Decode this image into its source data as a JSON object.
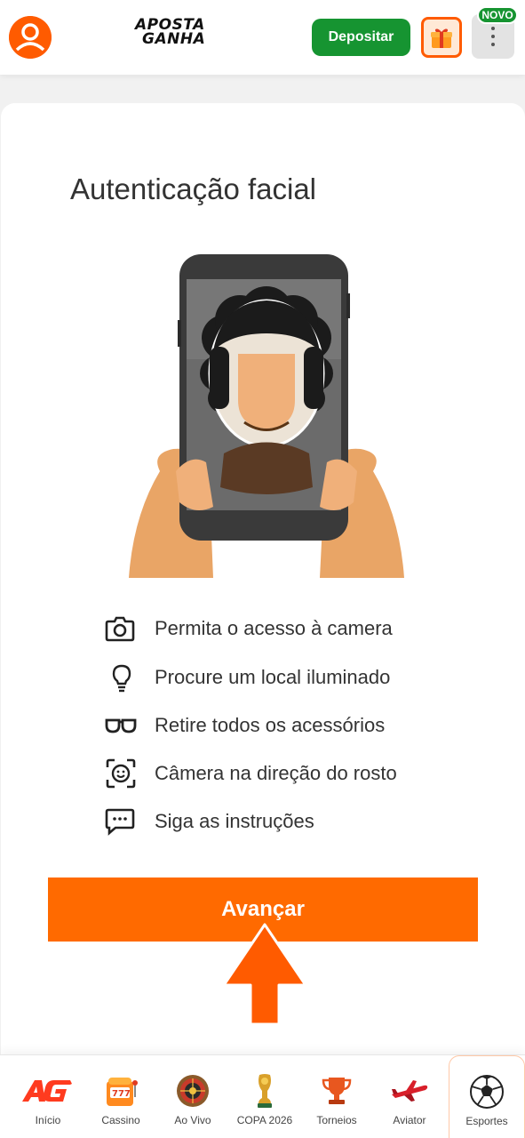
{
  "header": {
    "logo_line1": "APOSTA",
    "logo_line2": "GANHA",
    "deposit_label": "Depositar",
    "badge_label": "NOVO"
  },
  "main": {
    "title": "Autenticação facial",
    "tips": [
      {
        "icon": "camera-icon",
        "text": "Permita o acesso à camera"
      },
      {
        "icon": "lightbulb-icon",
        "text": "Procure um local iluminado"
      },
      {
        "icon": "glasses-icon",
        "text": "Retire todos os acessórios"
      },
      {
        "icon": "face-scan-icon",
        "text": "Câmera na direção do rosto"
      },
      {
        "icon": "chat-icon",
        "text": "Siga as instruções"
      }
    ],
    "advance_label": "Avançar"
  },
  "bottom_nav": [
    {
      "icon": "ag-logo-icon",
      "label": "Início"
    },
    {
      "icon": "slot-machine-icon",
      "label": "Cassino"
    },
    {
      "icon": "roulette-icon",
      "label": "Ao Vivo"
    },
    {
      "icon": "trophy-cup-icon",
      "label": "COPA 2026"
    },
    {
      "icon": "trophy-icon",
      "label": "Torneios"
    },
    {
      "icon": "airplane-icon",
      "label": "Aviator"
    },
    {
      "icon": "soccer-ball-icon",
      "label": "Esportes",
      "active": true
    }
  ],
  "colors": {
    "brand_orange": "#ff6a00",
    "deposit_green": "#169431"
  }
}
